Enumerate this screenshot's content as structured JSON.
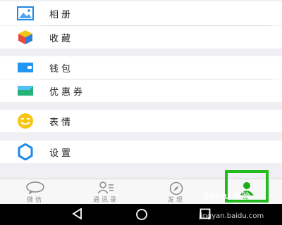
{
  "menu": {
    "album": "相册",
    "favorites": "收藏",
    "wallet": "钱包",
    "coupons": "优惠券",
    "stickers": "表情",
    "settings": "设置"
  },
  "tabs": [
    {
      "label": "微信",
      "icon": "chat-bubble-icon"
    },
    {
      "label": "通讯录",
      "icon": "contacts-icon"
    },
    {
      "label": "发现",
      "icon": "compass-icon"
    },
    {
      "label": "我",
      "icon": "person-icon"
    }
  ],
  "watermark": {
    "brand": "Baidu 经验",
    "url": "jingyan.baidu.com"
  },
  "colors": {
    "accent": "#1aad19",
    "highlight_box": "#22bb1c",
    "wallet_blue": "#2196f3",
    "sticker_yellow": "#f5c518",
    "settings_blue": "#1e88e5"
  }
}
